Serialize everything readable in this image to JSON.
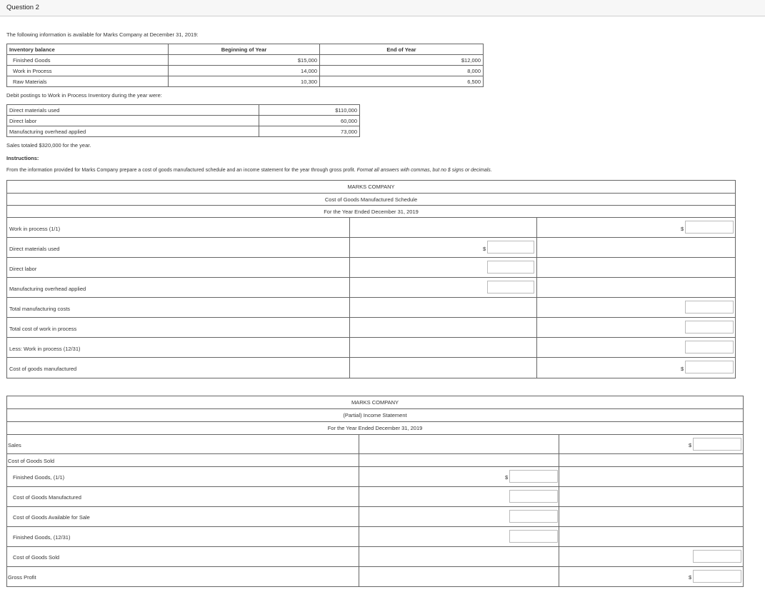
{
  "question_title": "Question 2",
  "intro": "The following information is available for Marks Company at December 31, 2019:",
  "inventory": {
    "headers": [
      "Inventory balance",
      "Beginning of Year",
      "End of Year"
    ],
    "rows": [
      {
        "label": "Finished Goods",
        "begin": "$15,000",
        "end": "$12,000"
      },
      {
        "label": "Work in Process",
        "begin": "14,000",
        "end": "8,000"
      },
      {
        "label": "Raw Materials",
        "begin": "10,300",
        "end": "6,500"
      }
    ]
  },
  "debit_intro": "Debit postings to Work in Process Inventory during the year were:",
  "debits": [
    {
      "label": "Direct materials used",
      "value": "$110,000"
    },
    {
      "label": "Direct labor",
      "value": "60,000"
    },
    {
      "label": "Manufacturing overhead applied",
      "value": "73,000"
    }
  ],
  "sales_note": "Sales totaled $320,000 for the year.",
  "instructions_label": "Instructions:",
  "instructions_text": "From the information provided for Marks Company prepare a cost of goods manufactured schedule and an income statement for the year through gross profit.",
  "instructions_italic": "Format all answers with commas, but no $ signs or decimals.",
  "cogm": {
    "company": "MARKS COMPANY",
    "title": "Cost of Goods Manufactured Schedule",
    "period": "For the Year Ended December 31, 2019",
    "rows": [
      "Work in process (1/1)",
      "Direct materials used",
      "Direct labor",
      "Manufacturing overhead applied",
      "Total manufacturing costs",
      "Total cost of work in process",
      "Less: Work in process (12/31)",
      "Cost of goods manufactured"
    ]
  },
  "income": {
    "company": "MARKS COMPANY",
    "title": "(Partial) Income Statement",
    "period": "For the Year Ended December 31, 2019",
    "rows": [
      "Sales",
      "Cost of Goods Sold",
      "Finished Goods, (1/1)",
      "Cost of Goods Manufactured",
      "Cost of Goods Available for Sale",
      "Finished Goods, (12/31)",
      "Cost of Goods Sold",
      "Gross Profit"
    ]
  },
  "currency_symbol": "$"
}
